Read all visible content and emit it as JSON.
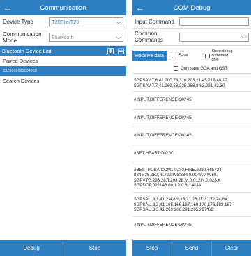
{
  "left": {
    "title": "Communication",
    "back_icon": "arrow-left-icon",
    "device_type": {
      "label": "Device Type",
      "value": "T20Pro/T20"
    },
    "comm_mode": {
      "label": "Communication Mode",
      "value": "Bluetooth"
    },
    "bt_list_header": "Bluetooth Device List",
    "paired_label": "Paired Devices",
    "selected_device": "2323668661004969",
    "search_label": "Search Devices",
    "buttons": {
      "debug": "Debug",
      "stop": "Stop"
    }
  },
  "right": {
    "title": "COM Debug",
    "back_icon": "arrow-left-icon",
    "input_command_label": "Input Command",
    "common_commands_label": "Common Commands",
    "receive_label": "Receive data",
    "save_label": "Save",
    "show_debug_label": "Show debug command only",
    "only_gga_label": "Only save GGA and GST",
    "log": [
      "$GPSAV,7,6,41,200,76,310,203,21,45,219,48,12,\n$GPSAV,7,7,41,269,56,235,286,8,63,291,42,30",
      "#INPUT,DIFFERENCE,OK*45",
      "#INPUT,DIFFERENCE,OK*45",
      "#INPUT,DIFFERENCE,OK*45",
      "#SET,HEART,OK*0C",
      "#BESTPOSA,COM1,0,0.0,FINE,2290,465724.\n8846,36.982,-6.722,WGS84,0.0049,0.0050,\n$GPVTG,293.28,T,293.28,M,0.012,N,0.023,K\n$GPDOP,092146.00,1.2,0.6,1.4*44",
      "$GPSAU,3,1,41,2,4,8,9,16,21,26,27,31,72,74,84,\n$GPSAU,3,2,41,165,166,167,169,170,176,183,187\n$GPSAU,3,3,41,269,286,291,295,297*6C",
      "#INPUT,DIFFERENCE,OK*45"
    ],
    "buttons": {
      "stop": "Stop",
      "send": "Send",
      "clear": "Clear"
    }
  },
  "colors": {
    "accent": "#2e7fc1",
    "link": "#2e7fc1"
  }
}
